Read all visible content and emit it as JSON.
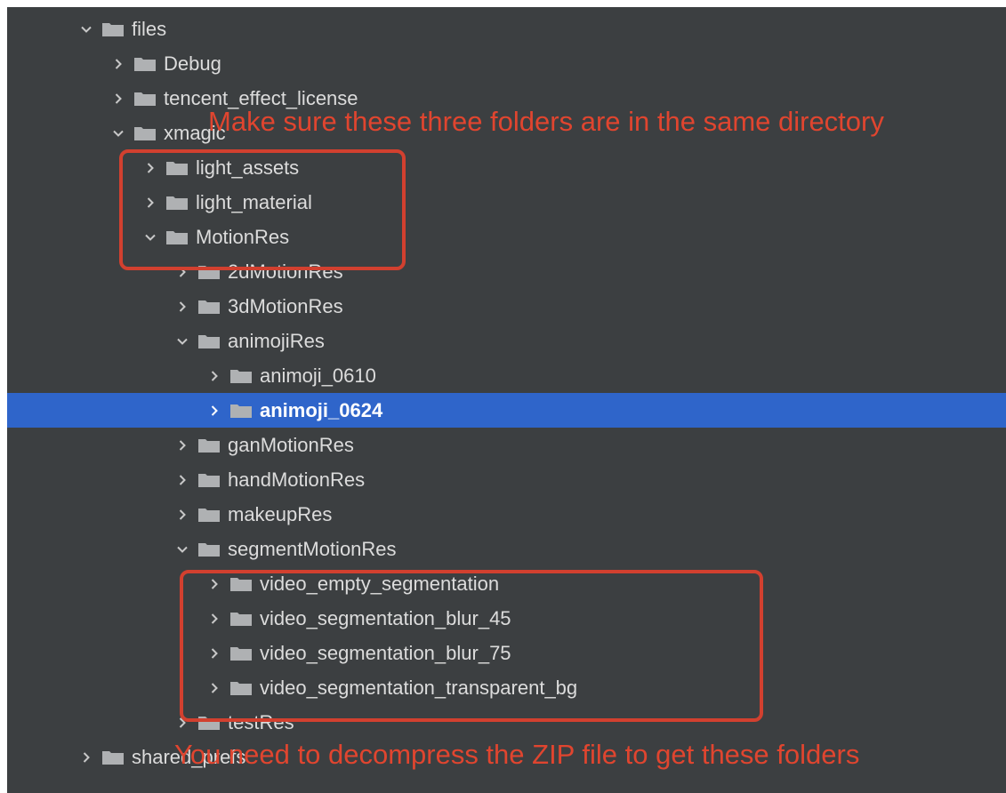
{
  "colors": {
    "panel_bg": "#3c3f41",
    "text": "#dcdcdc",
    "selected_bg": "#2f65ca",
    "folder_icon": "#afb1b3",
    "annotation_red": "#e0452f"
  },
  "tree": [
    {
      "label": "files",
      "expanded": true,
      "depth": 0
    },
    {
      "label": "Debug",
      "expanded": false,
      "depth": 1
    },
    {
      "label": "tencent_effect_license",
      "expanded": false,
      "depth": 1
    },
    {
      "label": "xmagic",
      "expanded": true,
      "depth": 1
    },
    {
      "label": "light_assets",
      "expanded": false,
      "depth": 2
    },
    {
      "label": "light_material",
      "expanded": false,
      "depth": 2
    },
    {
      "label": "MotionRes",
      "expanded": true,
      "depth": 2
    },
    {
      "label": "2dMotionRes",
      "expanded": false,
      "depth": 3
    },
    {
      "label": "3dMotionRes",
      "expanded": false,
      "depth": 3
    },
    {
      "label": "animojiRes",
      "expanded": true,
      "depth": 3
    },
    {
      "label": "animoji_0610",
      "expanded": false,
      "depth": 4
    },
    {
      "label": "animoji_0624",
      "expanded": false,
      "depth": 4,
      "selected": true
    },
    {
      "label": "ganMotionRes",
      "expanded": false,
      "depth": 3
    },
    {
      "label": "handMotionRes",
      "expanded": false,
      "depth": 3
    },
    {
      "label": "makeupRes",
      "expanded": false,
      "depth": 3
    },
    {
      "label": "segmentMotionRes",
      "expanded": true,
      "depth": 3
    },
    {
      "label": "video_empty_segmentation",
      "expanded": false,
      "depth": 4
    },
    {
      "label": "video_segmentation_blur_45",
      "expanded": false,
      "depth": 4
    },
    {
      "label": "video_segmentation_blur_75",
      "expanded": false,
      "depth": 4
    },
    {
      "label": "video_segmentation_transparent_bg",
      "expanded": false,
      "depth": 4
    },
    {
      "label": "testRes",
      "expanded": false,
      "depth": 3
    },
    {
      "label": "shared_prefs",
      "expanded": false,
      "depth": 0
    }
  ],
  "annotations": {
    "top": "Make sure these three folders are in the same directory",
    "bottom": "You need to decompress the ZIP file to get these folders"
  }
}
